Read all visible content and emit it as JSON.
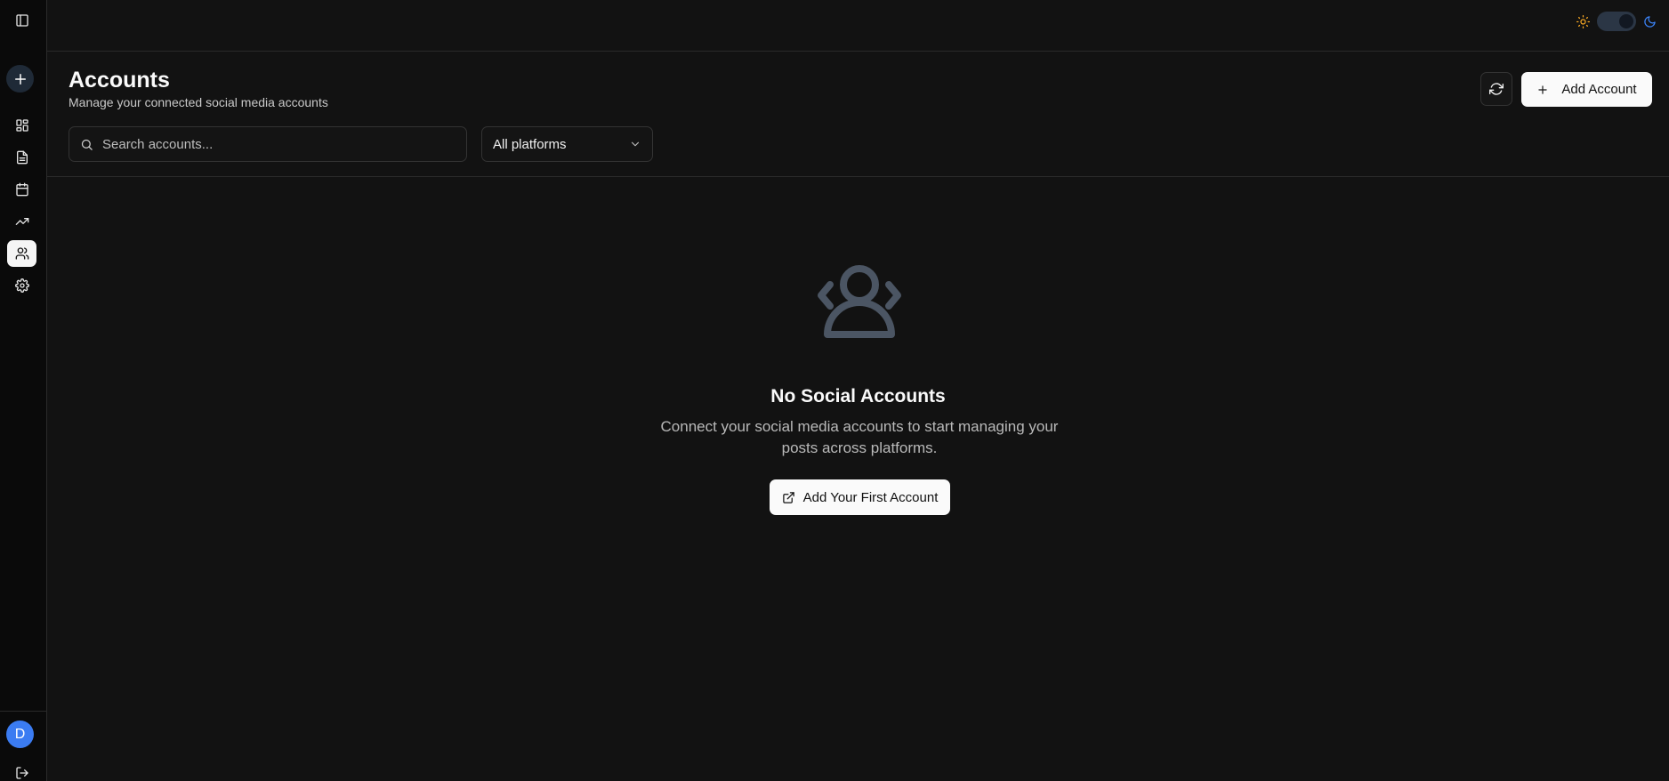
{
  "sidebar": {
    "items": [
      {
        "name": "dashboard",
        "icon": "dashboard-grid-icon"
      },
      {
        "name": "posts",
        "icon": "document-icon"
      },
      {
        "name": "calendar",
        "icon": "calendar-icon"
      },
      {
        "name": "analytics",
        "icon": "trending-up-icon"
      },
      {
        "name": "accounts",
        "icon": "users-icon",
        "active": true
      },
      {
        "name": "settings",
        "icon": "gear-icon"
      }
    ],
    "avatar_initial": "D"
  },
  "theme": {
    "sun_color": "#f5a623",
    "moon_color": "#3b82f6"
  },
  "header": {
    "title": "Accounts",
    "subtitle": "Manage your connected social media accounts",
    "add_button_label": "Add Account"
  },
  "filters": {
    "search_placeholder": "Search accounts...",
    "platform_selected": "All platforms"
  },
  "empty_state": {
    "title": "No Social Accounts",
    "text": "Connect your social media accounts to start managing your posts across platforms.",
    "button_label": "Add Your First Account"
  },
  "colors": {
    "background": "#121212",
    "accent_blue": "#3b7cf2",
    "icon_muted": "#4b5563"
  }
}
